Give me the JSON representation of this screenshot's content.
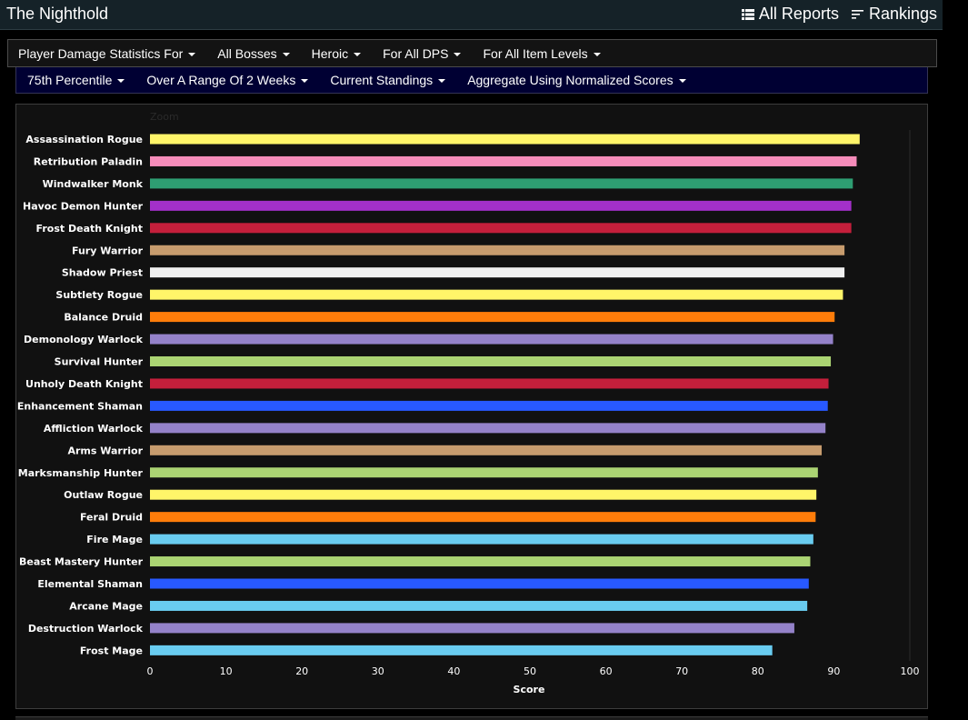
{
  "header": {
    "title": "The Nighthold"
  },
  "nav": [
    {
      "label": "All Reports",
      "icon": "list-icon"
    },
    {
      "label": "Rankings",
      "icon": "sort-lines-icon"
    }
  ],
  "filters_row1": [
    "Player Damage Statistics For",
    "All Bosses",
    "Heroic",
    "For All DPS",
    "For All Item Levels"
  ],
  "filters_row2": [
    "75th Percentile",
    "Over A Range Of 2 Weeks",
    "Current Standings",
    "Aggregate Using Normalized Scores"
  ],
  "chart_data": {
    "type": "bar",
    "orientation": "horizontal",
    "zoom_label": "Zoom",
    "xlabel": "Score",
    "xlim": [
      0,
      100
    ],
    "xticks": [
      0,
      10,
      20,
      30,
      40,
      50,
      60,
      70,
      80,
      90,
      100
    ],
    "grid": false,
    "categories": [
      "Assassination Rogue",
      "Retribution Paladin",
      "Windwalker Monk",
      "Havoc Demon Hunter",
      "Frost Death Knight",
      "Fury Warrior",
      "Shadow Priest",
      "Subtlety Rogue",
      "Balance Druid",
      "Demonology Warlock",
      "Survival Hunter",
      "Unholy Death Knight",
      "Enhancement Shaman",
      "Affliction Warlock",
      "Arms Warrior",
      "Marksmanship Hunter",
      "Outlaw Rogue",
      "Feral Druid",
      "Fire Mage",
      "Beast Mastery Hunter",
      "Elemental Shaman",
      "Arcane Mage",
      "Destruction Warlock",
      "Frost Mage"
    ],
    "values": [
      93.4,
      93.0,
      92.5,
      92.3,
      92.3,
      91.4,
      91.4,
      91.2,
      90.1,
      89.9,
      89.6,
      89.3,
      89.2,
      88.9,
      88.4,
      87.9,
      87.7,
      87.6,
      87.3,
      86.9,
      86.7,
      86.5,
      84.8,
      81.9
    ],
    "colors": [
      "#FFF569",
      "#F58CBA",
      "#2E9E72",
      "#A330C9",
      "#C41F3B",
      "#C79C6E",
      "#F0F0F0",
      "#FFF569",
      "#FF7D0A",
      "#9482C9",
      "#ABD473",
      "#C41F3B",
      "#2859FF",
      "#9482C9",
      "#C79C6E",
      "#ABD473",
      "#FFF569",
      "#FF7D0A",
      "#69CCF0",
      "#ABD473",
      "#2859FF",
      "#69CCF0",
      "#9482C9",
      "#69CCF0"
    ]
  }
}
